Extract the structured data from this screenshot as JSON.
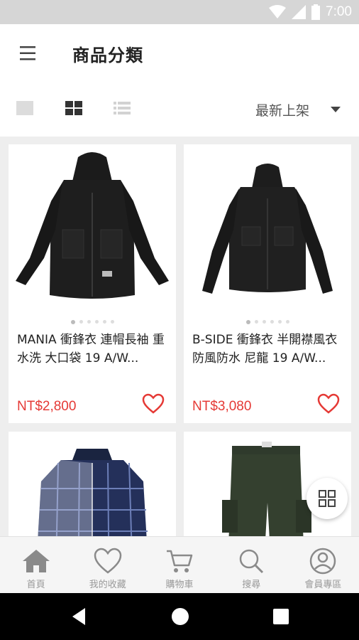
{
  "status_bar": {
    "time": "7:00"
  },
  "header": {
    "title": "商品分類",
    "menu_icon": "menu-icon"
  },
  "toolbar": {
    "views": [
      "single-view-icon",
      "grid-view-icon",
      "list-view-icon"
    ],
    "selected_view": "grid-view-icon",
    "sort_label": "最新上架"
  },
  "products": [
    {
      "name": "MANIA 衝鋒衣 連帽長袖 重水洗 大口袋 19 A/W...",
      "price": "NT$2,800",
      "favorite_icon": "heart-outline-icon"
    },
    {
      "name": "B-SIDE 衝鋒衣 半開襟風衣 防風防水 尼龍 19 A/W...",
      "price": "NT$3,080",
      "favorite_icon": "heart-outline-icon"
    },
    {
      "name": "",
      "price": ""
    },
    {
      "name": "",
      "price": ""
    }
  ],
  "tabs": [
    {
      "label": "首頁",
      "icon": "home-icon"
    },
    {
      "label": "我的收藏",
      "icon": "heart-icon"
    },
    {
      "label": "購物車",
      "icon": "cart-icon"
    },
    {
      "label": "搜尋",
      "icon": "search-icon"
    },
    {
      "label": "會員專區",
      "icon": "user-icon"
    }
  ],
  "colors": {
    "price": "#e53935",
    "tab_inactive": "#999999",
    "accent_gray": "#d6d6d6"
  }
}
